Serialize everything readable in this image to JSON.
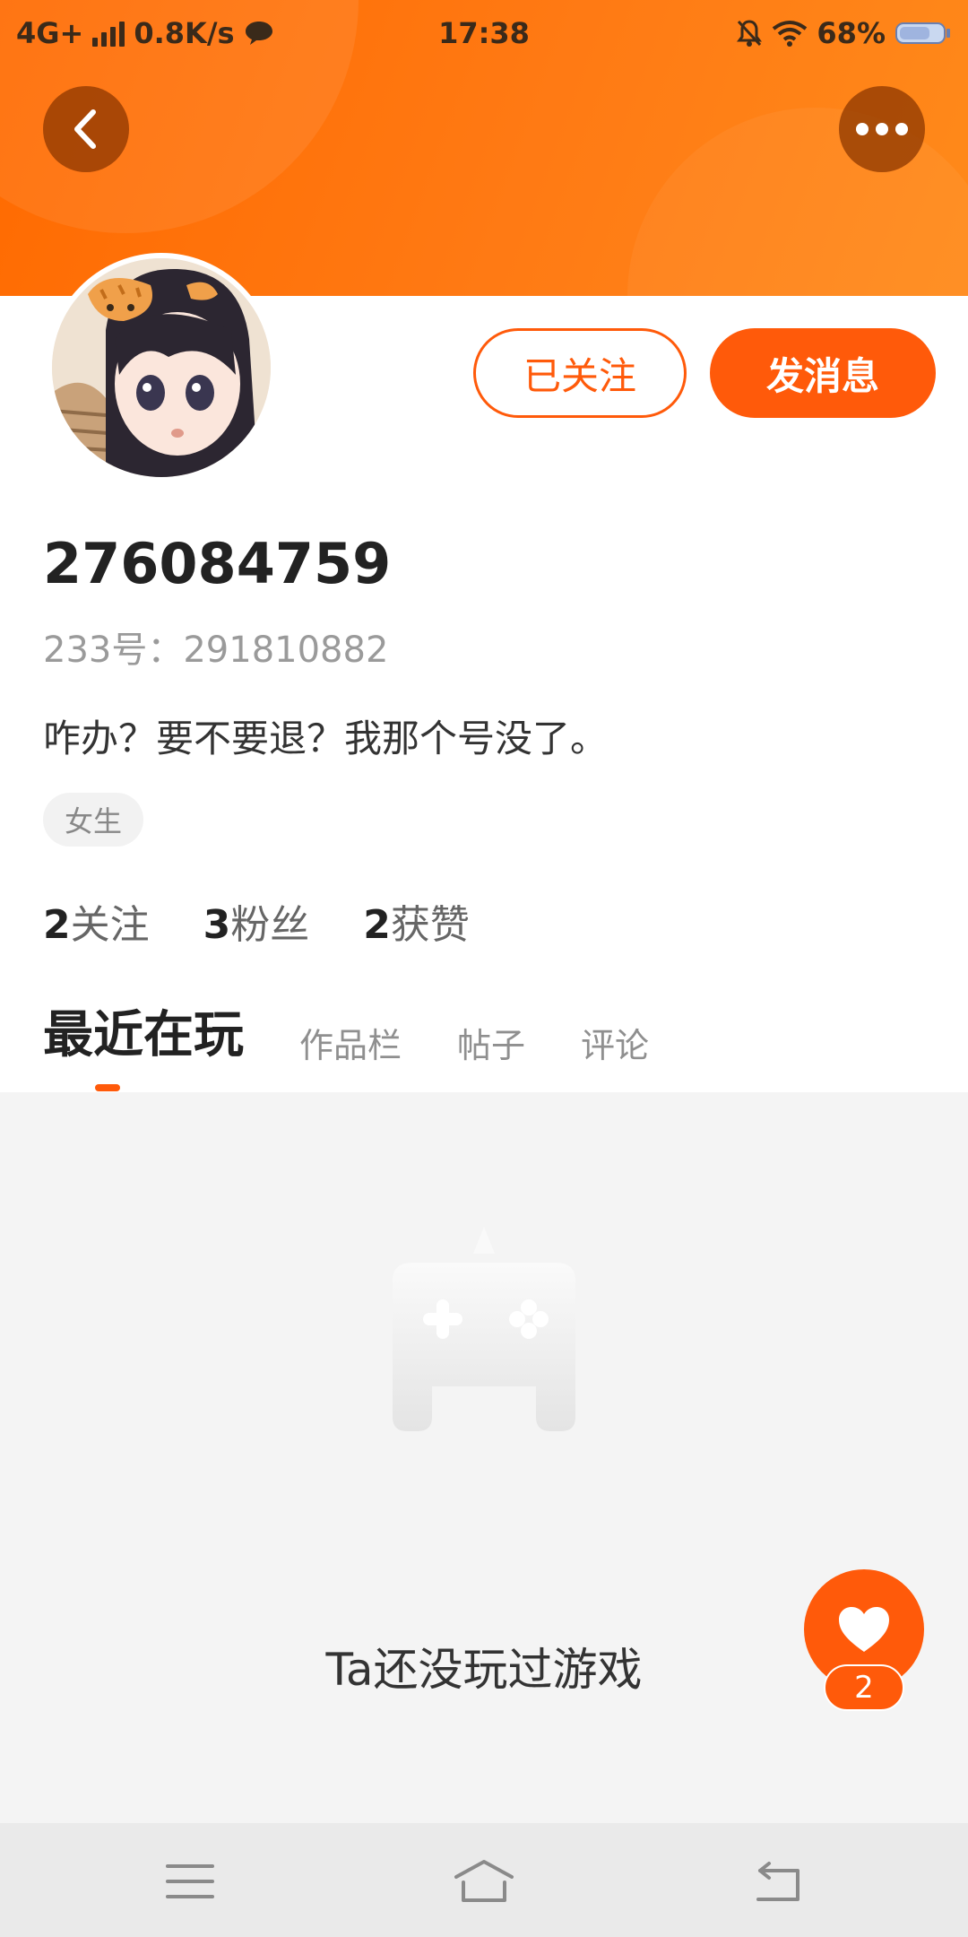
{
  "status_bar": {
    "network": "4G+",
    "speed": "0.8K/s",
    "time": "17:38",
    "battery": "68%"
  },
  "header": {
    "back_icon": "chevron-left-icon",
    "more_icon": "more-dots-icon"
  },
  "profile": {
    "follow_state_label": "已关注",
    "message_label": "发消息",
    "username": "276084759",
    "uid_text": "233号：291810882",
    "bio": "咋办？要不要退？我那个号没了。",
    "gender_tag": "女生",
    "stats": [
      {
        "count": "2",
        "label": "关注"
      },
      {
        "count": "3",
        "label": "粉丝"
      },
      {
        "count": "2",
        "label": "获赞"
      }
    ]
  },
  "tabs": [
    {
      "label": "最近在玩",
      "active": true
    },
    {
      "label": "作品栏",
      "active": false
    },
    {
      "label": "帖子",
      "active": false
    },
    {
      "label": "评论",
      "active": false
    }
  ],
  "empty_state": {
    "icon": "gamepad-icon",
    "message": "Ta还没玩过游戏"
  },
  "fab": {
    "icon": "heart-icon",
    "count": "2"
  },
  "navbar": {
    "menu_icon": "menu-icon",
    "home_icon": "home-icon",
    "back_icon": "back-icon"
  },
  "colors": {
    "accent": "#ff5a0a",
    "header_gradient_start": "#ff6a00",
    "header_gradient_end": "#ff8a1a",
    "content_bg": "#f4f4f4"
  }
}
